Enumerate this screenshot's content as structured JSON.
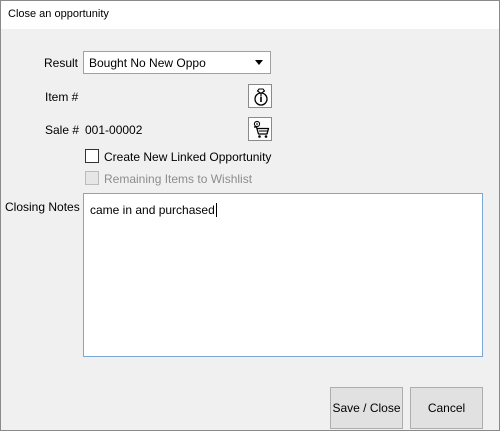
{
  "window": {
    "title": "Close an opportunity"
  },
  "form": {
    "result": {
      "label": "Result",
      "value": "Bought No New Oppo"
    },
    "item": {
      "label": "Item #",
      "value": ""
    },
    "sale": {
      "label": "Sale #",
      "value": "001-00002"
    },
    "create_linked": {
      "label": "Create New Linked Opportunity",
      "checked": false,
      "enabled": true
    },
    "remaining_items": {
      "label": "Remaining Items to Wishlist",
      "checked": false,
      "enabled": false
    },
    "closing_notes": {
      "label": "Closing Notes",
      "value": "came in and purchased"
    }
  },
  "icons": {
    "item_lookup": "ring-search-icon",
    "sale_lookup": "cart-search-icon"
  },
  "buttons": {
    "save_close": "Save / Close",
    "cancel": "Cancel"
  }
}
